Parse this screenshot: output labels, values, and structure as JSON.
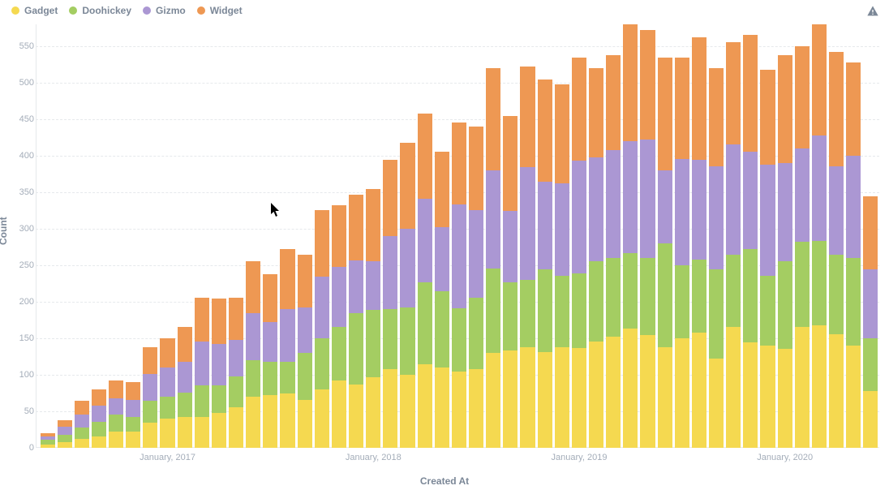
{
  "chart_data": {
    "type": "bar",
    "stacked": true,
    "title": "",
    "xlabel": "Created At",
    "ylabel": "Count",
    "ylim": [
      0,
      580
    ],
    "y_ticks": [
      0,
      50,
      100,
      150,
      200,
      250,
      300,
      350,
      400,
      450,
      500,
      550
    ],
    "x_tick_labels": [
      {
        "index": 7,
        "label": "January, 2017"
      },
      {
        "index": 19,
        "label": "January, 2018"
      },
      {
        "index": 31,
        "label": "January, 2019"
      },
      {
        "index": 43,
        "label": "January, 2020"
      }
    ],
    "series": [
      {
        "name": "Gadget",
        "color": "#f5d950"
      },
      {
        "name": "Doohickey",
        "color": "#a4cd62"
      },
      {
        "name": "Gizmo",
        "color": "#ab97d3"
      },
      {
        "name": "Widget",
        "color": "#ee9853"
      }
    ],
    "categories_count": 48,
    "values": [
      {
        "Gadget": 5,
        "Doohickey": 6,
        "Gizmo": 5,
        "Widget": 4
      },
      {
        "Gadget": 8,
        "Doohickey": 10,
        "Gizmo": 11,
        "Widget": 9
      },
      {
        "Gadget": 12,
        "Doohickey": 16,
        "Gizmo": 18,
        "Widget": 18
      },
      {
        "Gadget": 16,
        "Doohickey": 20,
        "Gizmo": 22,
        "Widget": 22
      },
      {
        "Gadget": 22,
        "Doohickey": 24,
        "Gizmo": 22,
        "Widget": 24
      },
      {
        "Gadget": 22,
        "Doohickey": 20,
        "Gizmo": 24,
        "Widget": 24
      },
      {
        "Gadget": 35,
        "Doohickey": 30,
        "Gizmo": 36,
        "Widget": 37
      },
      {
        "Gadget": 40,
        "Doohickey": 30,
        "Gizmo": 40,
        "Widget": 40
      },
      {
        "Gadget": 42,
        "Doohickey": 34,
        "Gizmo": 42,
        "Widget": 48
      },
      {
        "Gadget": 42,
        "Doohickey": 44,
        "Gizmo": 60,
        "Widget": 60
      },
      {
        "Gadget": 48,
        "Doohickey": 38,
        "Gizmo": 56,
        "Widget": 62
      },
      {
        "Gadget": 56,
        "Doohickey": 42,
        "Gizmo": 50,
        "Widget": 58
      },
      {
        "Gadget": 70,
        "Doohickey": 50,
        "Gizmo": 64,
        "Widget": 72
      },
      {
        "Gadget": 72,
        "Doohickey": 46,
        "Gizmo": 54,
        "Widget": 66
      },
      {
        "Gadget": 74,
        "Doohickey": 44,
        "Gizmo": 72,
        "Widget": 82
      },
      {
        "Gadget": 66,
        "Doohickey": 64,
        "Gizmo": 62,
        "Widget": 72
      },
      {
        "Gadget": 80,
        "Doohickey": 70,
        "Gizmo": 84,
        "Widget": 92
      },
      {
        "Gadget": 92,
        "Doohickey": 74,
        "Gizmo": 82,
        "Widget": 84
      },
      {
        "Gadget": 87,
        "Doohickey": 98,
        "Gizmo": 72,
        "Widget": 90
      },
      {
        "Gadget": 97,
        "Doohickey": 92,
        "Gizmo": 67,
        "Widget": 98
      },
      {
        "Gadget": 108,
        "Doohickey": 82,
        "Gizmo": 100,
        "Widget": 104
      },
      {
        "Gadget": 100,
        "Doohickey": 92,
        "Gizmo": 108,
        "Widget": 118
      },
      {
        "Gadget": 115,
        "Doohickey": 112,
        "Gizmo": 114,
        "Widget": 117
      },
      {
        "Gadget": 110,
        "Doohickey": 104,
        "Gizmo": 88,
        "Widget": 104
      },
      {
        "Gadget": 105,
        "Doohickey": 86,
        "Gizmo": 142,
        "Widget": 113
      },
      {
        "Gadget": 108,
        "Doohickey": 98,
        "Gizmo": 120,
        "Widget": 114
      },
      {
        "Gadget": 130,
        "Doohickey": 116,
        "Gizmo": 134,
        "Widget": 140
      },
      {
        "Gadget": 133,
        "Doohickey": 94,
        "Gizmo": 98,
        "Widget": 130
      },
      {
        "Gadget": 138,
        "Doohickey": 92,
        "Gizmo": 154,
        "Widget": 138
      },
      {
        "Gadget": 131,
        "Doohickey": 113,
        "Gizmo": 120,
        "Widget": 140
      },
      {
        "Gadget": 138,
        "Doohickey": 98,
        "Gizmo": 126,
        "Widget": 136
      },
      {
        "Gadget": 137,
        "Doohickey": 102,
        "Gizmo": 154,
        "Widget": 142
      },
      {
        "Gadget": 146,
        "Doohickey": 110,
        "Gizmo": 142,
        "Widget": 122
      },
      {
        "Gadget": 152,
        "Doohickey": 108,
        "Gizmo": 148,
        "Widget": 130
      },
      {
        "Gadget": 164,
        "Doohickey": 104,
        "Gizmo": 154,
        "Widget": 160
      },
      {
        "Gadget": 154,
        "Doohickey": 106,
        "Gizmo": 162,
        "Widget": 150
      },
      {
        "Gadget": 138,
        "Doohickey": 142,
        "Gizmo": 100,
        "Widget": 154
      },
      {
        "Gadget": 150,
        "Doohickey": 100,
        "Gizmo": 146,
        "Widget": 138
      },
      {
        "Gadget": 158,
        "Doohickey": 100,
        "Gizmo": 136,
        "Widget": 168
      },
      {
        "Gadget": 122,
        "Doohickey": 122,
        "Gizmo": 142,
        "Widget": 134
      },
      {
        "Gadget": 166,
        "Doohickey": 98,
        "Gizmo": 152,
        "Widget": 140
      },
      {
        "Gadget": 144,
        "Doohickey": 128,
        "Gizmo": 134,
        "Widget": 160
      },
      {
        "Gadget": 140,
        "Doohickey": 96,
        "Gizmo": 152,
        "Widget": 130
      },
      {
        "Gadget": 136,
        "Doohickey": 120,
        "Gizmo": 134,
        "Widget": 148
      },
      {
        "Gadget": 166,
        "Doohickey": 116,
        "Gizmo": 128,
        "Widget": 140
      },
      {
        "Gadget": 168,
        "Doohickey": 116,
        "Gizmo": 145,
        "Widget": 152
      },
      {
        "Gadget": 156,
        "Doohickey": 108,
        "Gizmo": 122,
        "Widget": 156
      },
      {
        "Gadget": 140,
        "Doohickey": 120,
        "Gizmo": 140,
        "Widget": 128
      },
      {
        "Gadget": 78,
        "Doohickey": 72,
        "Gizmo": 94,
        "Widget": 100
      }
    ]
  }
}
